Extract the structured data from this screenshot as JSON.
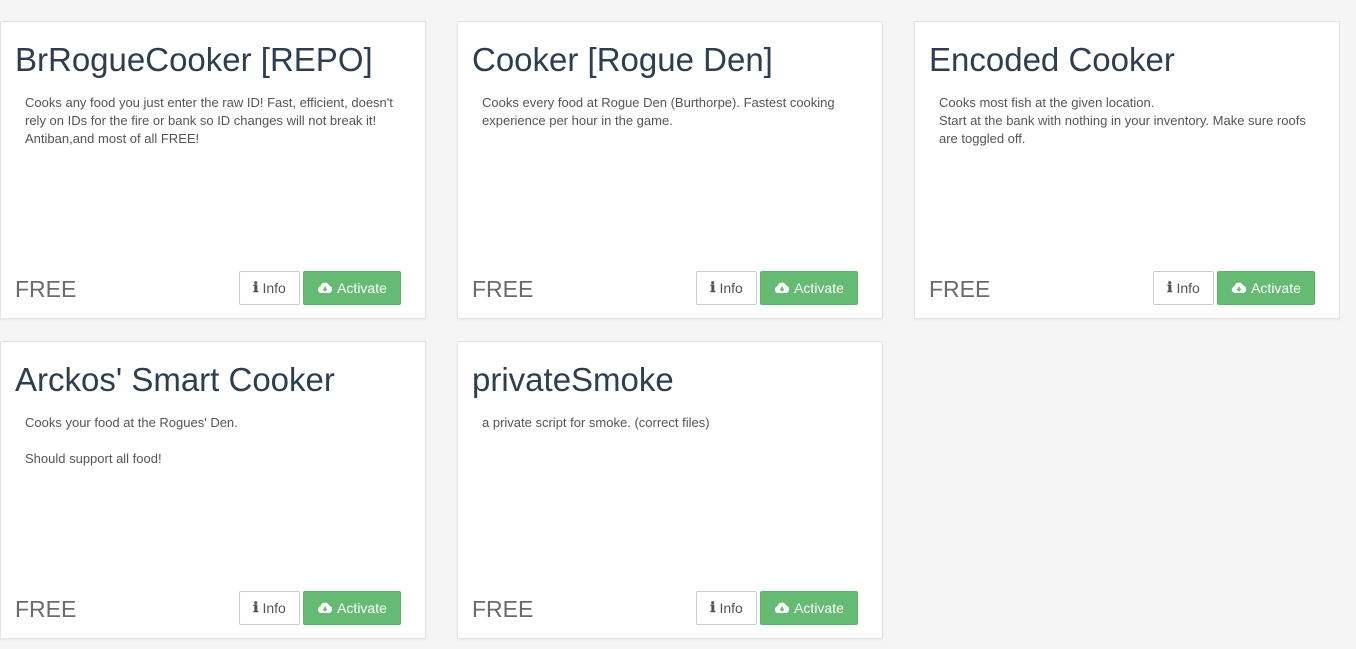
{
  "colors": {
    "background": "#f5f5f5",
    "card": "#ffffff",
    "activate": "#65bb73",
    "title": "#2c3e50"
  },
  "cards": [
    {
      "title": "BrRogueCooker [REPO]",
      "description": "Cooks any food you just enter the raw ID! Fast, efficient, doesn't rely on IDs for the fire or bank so ID changes will not break it! Antiban,and most of all FREE!",
      "price": "FREE",
      "info_label": "Info",
      "activate_label": "Activate"
    },
    {
      "title": "Cooker [Rogue Den]",
      "description": "Cooks every food at Rogue Den (Burthorpe). Fastest cooking experience per hour in the game.",
      "price": "FREE",
      "info_label": "Info",
      "activate_label": "Activate"
    },
    {
      "title": "Encoded Cooker",
      "description": "Cooks most fish at the given location.\nStart at the bank with nothing in your inventory. Make sure roofs are toggled off.",
      "price": "FREE",
      "info_label": "Info",
      "activate_label": "Activate"
    },
    {
      "title": "Arckos' Smart Cooker",
      "description": "Cooks your food at the Rogues' Den.\n\nShould support all food!",
      "price": "FREE",
      "info_label": "Info",
      "activate_label": "Activate"
    },
    {
      "title": "privateSmoke",
      "description": "a private script for smoke. (correct files)",
      "price": "FREE",
      "info_label": "Info",
      "activate_label": "Activate"
    }
  ],
  "icons": {
    "info": "info-icon",
    "activate": "cloud-download-icon"
  }
}
